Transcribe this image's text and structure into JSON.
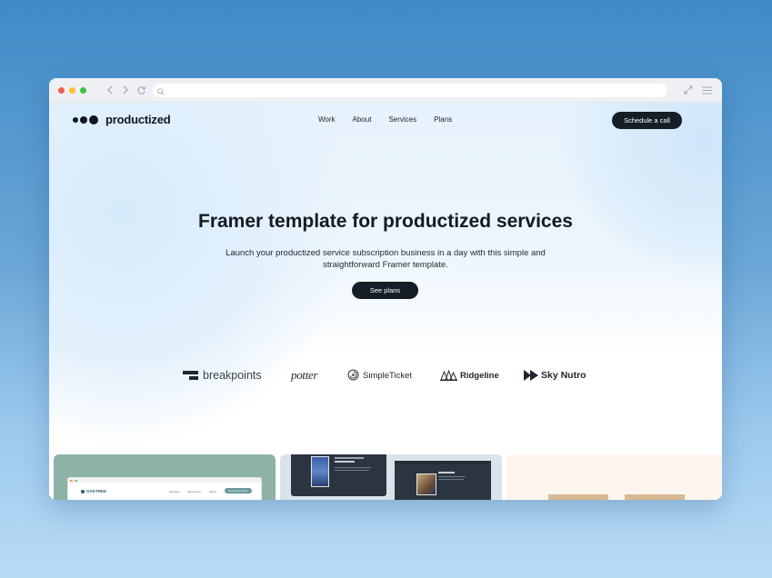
{
  "browser": {
    "dots": [
      "#f25f58",
      "#fbbe2e",
      "#39c640"
    ],
    "icons": [
      "back-icon",
      "forward-icon",
      "reload-icon",
      "search-icon",
      "expand-icon",
      "menu-icon"
    ]
  },
  "site": {
    "brand": "productized",
    "nav": [
      "Work",
      "About",
      "Services",
      "Plans"
    ],
    "cta": "Schedule a call"
  },
  "hero": {
    "title": "Framer template for productized services",
    "subtitle": "Launch your productized service subscription business in a day with this simple and straightforward Framer template.",
    "button": "See plans"
  },
  "clients": [
    "breakpoints",
    "potter",
    "SimpleTicket",
    "Ridgeline",
    "Sky Nutro"
  ],
  "preview_cards": {
    "card1": {
      "brand": "OAKTREE",
      "nav": [
        "Services",
        "Resources",
        "About"
      ],
      "cta": "Request a review"
    }
  },
  "colors": {
    "dark": "#151d25",
    "hero_tint": "#e6f2fc",
    "card1_bg": "#8fb2a6",
    "card2_bg": "#d9e3ea",
    "card3_bg": "#fbf5ee"
  }
}
